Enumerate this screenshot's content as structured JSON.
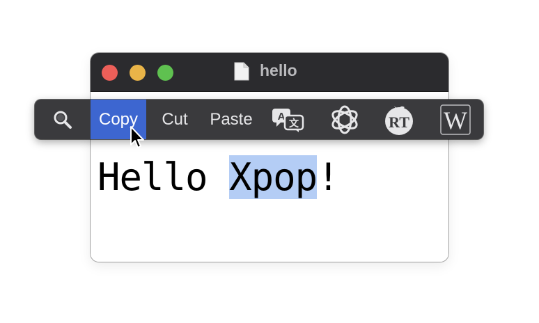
{
  "window": {
    "title": "hello",
    "title_icon": "document-icon"
  },
  "editor": {
    "text_before": "Hello ",
    "selected_text": "Xpop",
    "text_after": "!"
  },
  "popbar": {
    "search_icon": "magnifier-icon",
    "copy_label": "Copy",
    "cut_label": "Cut",
    "paste_label": "Paste",
    "translate_icon": "translate-icon",
    "chatgpt_icon": "openai-icon",
    "rt_icon": "rt-icon",
    "rt_text": "RT",
    "wiki_icon": "wikipedia-icon",
    "wiki_text": "W"
  },
  "colors": {
    "titlebar": "#2b2b2e",
    "popbar": "#3a3a3d",
    "copy_highlight": "#3d66d0",
    "selection": "#b4cdf5",
    "close": "#ec5f59",
    "minimize": "#e9b448",
    "maximize": "#5fc150"
  }
}
